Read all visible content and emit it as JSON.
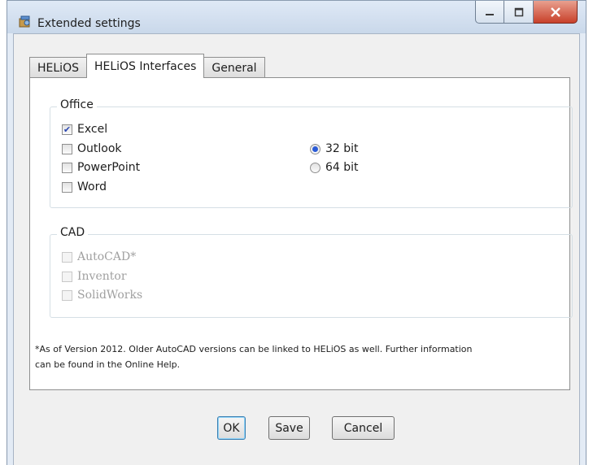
{
  "window": {
    "title": "Extended settings",
    "icon": "settings-app-icon"
  },
  "tabs": [
    {
      "label": "HELiOS",
      "active": false
    },
    {
      "label": "HELiOS Interfaces",
      "active": true
    },
    {
      "label": "General",
      "active": false
    }
  ],
  "office": {
    "legend": "Office",
    "items": [
      {
        "label": "Excel",
        "checked": true
      },
      {
        "label": "Outlook",
        "checked": false
      },
      {
        "label": "PowerPoint",
        "checked": false
      },
      {
        "label": "Word",
        "checked": false
      }
    ],
    "bitness": [
      {
        "label": "32 bit",
        "selected": true
      },
      {
        "label": "64 bit",
        "selected": false
      }
    ]
  },
  "cad": {
    "legend": "CAD",
    "items": [
      {
        "label": "AutoCAD*",
        "checked": false,
        "enabled": false
      },
      {
        "label": "Inventor",
        "checked": false,
        "enabled": false
      },
      {
        "label": "SolidWorks",
        "checked": false,
        "enabled": false
      }
    ]
  },
  "footnote": {
    "line1": "*As of Version 2012. Older AutoCAD versions can be linked to HELiOS as well.  Further information",
    "line2": "can be found in the Online Help."
  },
  "buttons": {
    "ok": "OK",
    "save": "Save",
    "cancel": "Cancel"
  },
  "colors": {
    "accent": "#2a5bd6",
    "close": "#c8402a"
  }
}
